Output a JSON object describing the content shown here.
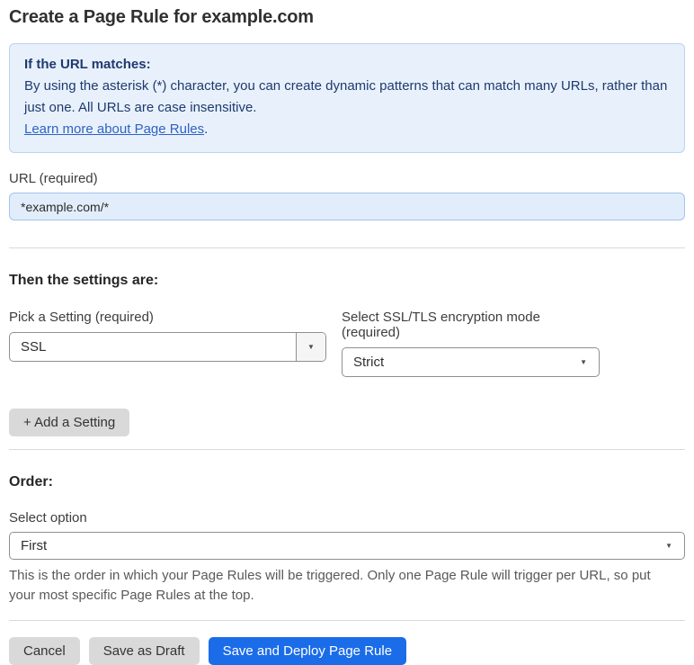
{
  "page": {
    "title": "Create a Page Rule for example.com"
  },
  "info_box": {
    "heading": "If the URL matches:",
    "body": "By using the asterisk (*) character, you can create dynamic patterns that can match many URLs, rather than just one. All URLs are case insensitive.",
    "link_label": "Learn more about Page Rules",
    "link_suffix": "."
  },
  "url_field": {
    "label": "URL (required)",
    "value": "*example.com/*"
  },
  "settings_section": {
    "heading": "Then the settings are:",
    "setting_picker": {
      "label": "Pick a Setting (required)",
      "value": "SSL"
    },
    "ssl_mode_picker": {
      "label": "Select SSL/TLS encryption mode (required)",
      "value": "Strict"
    },
    "add_setting_label": "+ Add a Setting"
  },
  "order_section": {
    "heading": "Order:",
    "select_label": "Select option",
    "value": "First",
    "helper_text": "This is the order in which your Page Rules will be triggered. Only one Page Rule will trigger per URL, so put your most specific Page Rules at the top."
  },
  "footer": {
    "cancel_label": "Cancel",
    "save_draft_label": "Save as Draft",
    "save_deploy_label": "Save and Deploy Page Rule"
  },
  "icons": {
    "dropdown_arrow": "▼"
  },
  "colors": {
    "accent_blue": "#1b6ce9",
    "info_bg": "#e8f1fb",
    "info_border": "#b9d5ef",
    "info_text": "#1e3a6e",
    "link_blue": "#2f62c4",
    "input_bg": "#e2edfb",
    "input_border": "#a2c4ec"
  }
}
